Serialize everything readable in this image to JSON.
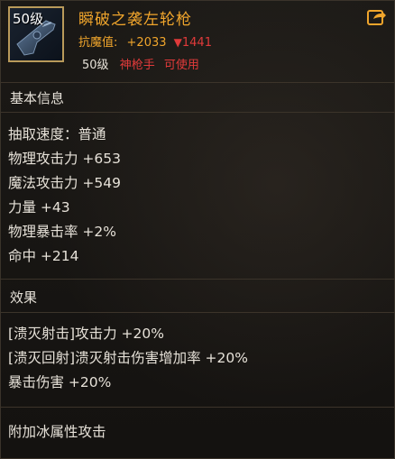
{
  "header": {
    "icon_level": "50级",
    "item_name": "瞬破之袭左轮枪",
    "stat_label": "抗魔值:",
    "stat_value": "+2033",
    "stat_diff": "1441",
    "req_level": "50级",
    "req_class": "神枪手",
    "req_usable": "可使用"
  },
  "basic_info": {
    "title": "基本信息",
    "lines": [
      "抽取速度：普通",
      "物理攻击力 +653",
      "魔法攻击力 +549",
      "力量 +43",
      "物理暴击率 +2%",
      "命中 +214"
    ]
  },
  "effects": {
    "title": "效果",
    "lines": [
      "[溃灭射击]攻击力 +20%",
      "[溃灭回射]溃灭射击伤害增加率 +20%",
      "暴击伤害 +20%"
    ]
  },
  "extra": {
    "line": "附加冰属性攻击"
  },
  "colors": {
    "name": "#f0a52c",
    "negative": "#e03a3a",
    "text": "#e6e1d8",
    "frame": "#b99a5a"
  },
  "icons": {
    "weapon": "revolver-icon",
    "share": "share-icon",
    "down": "down-arrow-icon"
  }
}
